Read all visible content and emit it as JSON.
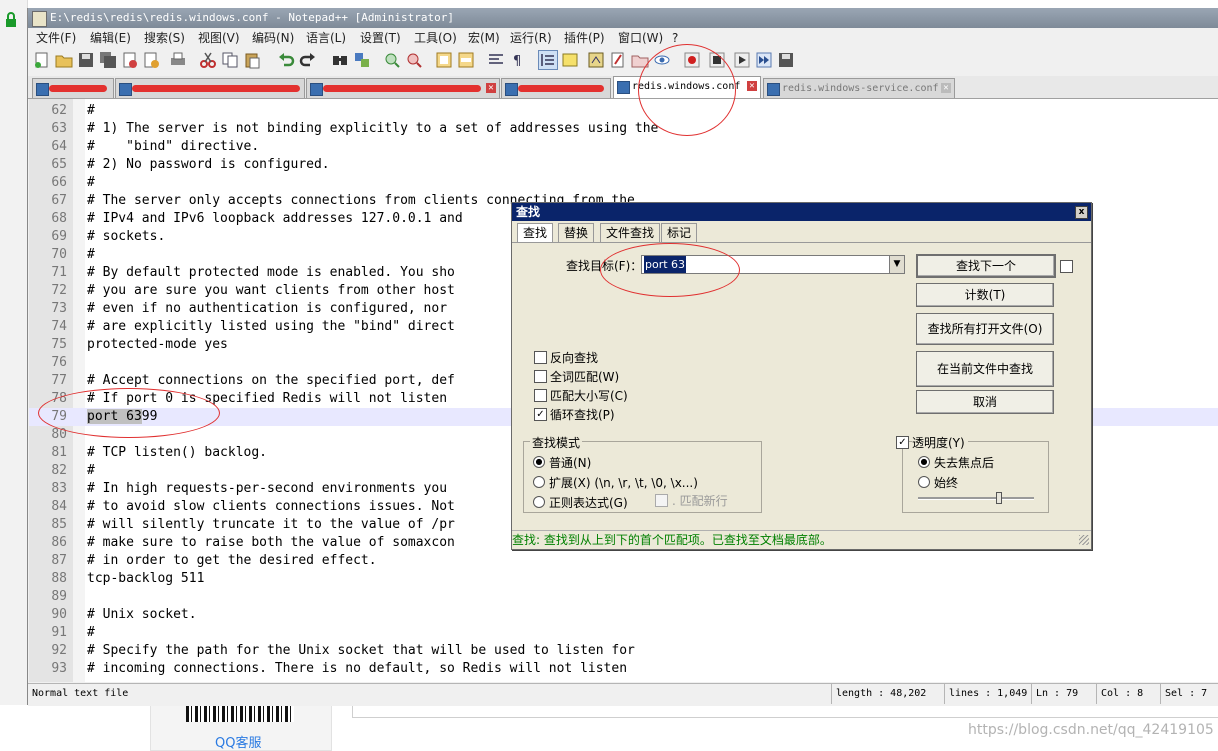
{
  "window": {
    "title": "E:\\redis\\redis\\redis.windows.conf - Notepad++ [Administrator]"
  },
  "menu": [
    "文件(F)",
    "编辑(E)",
    "搜索(S)",
    "视图(V)",
    "编码(N)",
    "语言(L)",
    "设置(T)",
    "工具(O)",
    "宏(M)",
    "运行(R)",
    "插件(P)",
    "窗口(W)",
    "?"
  ],
  "tabs": [
    {
      "label": "",
      "redacted": true
    },
    {
      "label": "",
      "redacted": true
    },
    {
      "label": "",
      "redacted": true
    },
    {
      "label": "",
      "redacted": true
    },
    {
      "label": "redis.windows.conf",
      "active": true
    },
    {
      "label": "redis.windows-service.conf"
    }
  ],
  "editor": {
    "lines": [
      {
        "n": "62",
        "text": "#"
      },
      {
        "n": "63",
        "text": "# 1) The server is not binding explicitly to a set of addresses using the"
      },
      {
        "n": "64",
        "text": "#    \"bind\" directive."
      },
      {
        "n": "65",
        "text": "# 2) No password is configured."
      },
      {
        "n": "66",
        "text": "#"
      },
      {
        "n": "67",
        "text": "# The server only accepts connections from clients connecting from the"
      },
      {
        "n": "68",
        "text": "# IPv4 and IPv6 loopback addresses 127.0.0.1 and"
      },
      {
        "n": "69",
        "text": "# sockets."
      },
      {
        "n": "70",
        "text": "#"
      },
      {
        "n": "71",
        "text": "# By default protected mode is enabled. You sho"
      },
      {
        "n": "72",
        "text": "# you are sure you want clients from other host"
      },
      {
        "n": "73",
        "text": "# even if no authentication is configured, nor"
      },
      {
        "n": "74",
        "text": "# are explicitly listed using the \"bind\" direct"
      },
      {
        "n": "75",
        "text": "protected-mode yes"
      },
      {
        "n": "76",
        "text": ""
      },
      {
        "n": "77",
        "text": "# Accept connections on the specified port, def"
      },
      {
        "n": "78",
        "text": "# If port 0 is specified Redis will not listen"
      },
      {
        "n": "79",
        "text_sel": "port 63",
        "text_rest": "99",
        "current": true
      },
      {
        "n": "80",
        "text": ""
      },
      {
        "n": "81",
        "text": "# TCP listen() backlog."
      },
      {
        "n": "82",
        "text": "#"
      },
      {
        "n": "83",
        "text": "# In high requests-per-second environments you"
      },
      {
        "n": "84",
        "text": "# to avoid slow clients connections issues. Not"
      },
      {
        "n": "85",
        "text": "# will silently truncate it to the value of /pr"
      },
      {
        "n": "86",
        "text": "# make sure to raise both the value of somaxcon"
      },
      {
        "n": "87",
        "text": "# in order to get the desired effect."
      },
      {
        "n": "88",
        "text": "tcp-backlog 511"
      },
      {
        "n": "89",
        "text": ""
      },
      {
        "n": "90",
        "text": "# Unix socket."
      },
      {
        "n": "91",
        "text": "#"
      },
      {
        "n": "92",
        "text": "# Specify the path for the Unix socket that will be used to listen for"
      },
      {
        "n": "93",
        "text": "# incoming connections. There is no default, so Redis will not listen"
      }
    ]
  },
  "statusbar": {
    "type": "Normal text file",
    "length": "length : 48,202",
    "lines": "lines : 1,049",
    "ln": "Ln : 79",
    "col": "Col : 8",
    "sel": "Sel : 7"
  },
  "find_dialog": {
    "title": "查找",
    "close": "x",
    "tabs": [
      "查找",
      "替换",
      "文件查找",
      "标记"
    ],
    "search_label": "查找目标(F)：",
    "search_value": "port 63",
    "buttons": {
      "find_next": "查找下一个",
      "count": "计数(T)",
      "find_all_open": "查找所有打开文件(O)",
      "find_all_current": "在当前文件中查找",
      "cancel": "取消"
    },
    "options": [
      {
        "label": "反向查找",
        "checked": false
      },
      {
        "label": "全词匹配(W)",
        "checked": false
      },
      {
        "label": "匹配大小写(C)",
        "checked": false
      },
      {
        "label": "循环查找(P)",
        "checked": true
      }
    ],
    "mode": {
      "title": "查找模式",
      "options": [
        {
          "label": "普通(N)",
          "selected": true
        },
        {
          "label": "扩展(X) (\\n, \\r, \\t, \\0, \\x...)",
          "selected": false
        },
        {
          "label": "正则表达式(G)",
          "selected": false
        }
      ],
      "matches_newline": ". 匹配新行"
    },
    "transparency": {
      "title": "透明度(Y)",
      "checked": true,
      "options": [
        {
          "label": "失去焦点后",
          "selected": true
        },
        {
          "label": "始终",
          "selected": false
        }
      ],
      "level": 0.7
    },
    "status": "查找: 查找到从上到下的首个匹配项。已查找至文档最底部。"
  },
  "background": {
    "qq_service": "QQ客服",
    "watermark": "https://blog.csdn.net/qq_42419105"
  }
}
